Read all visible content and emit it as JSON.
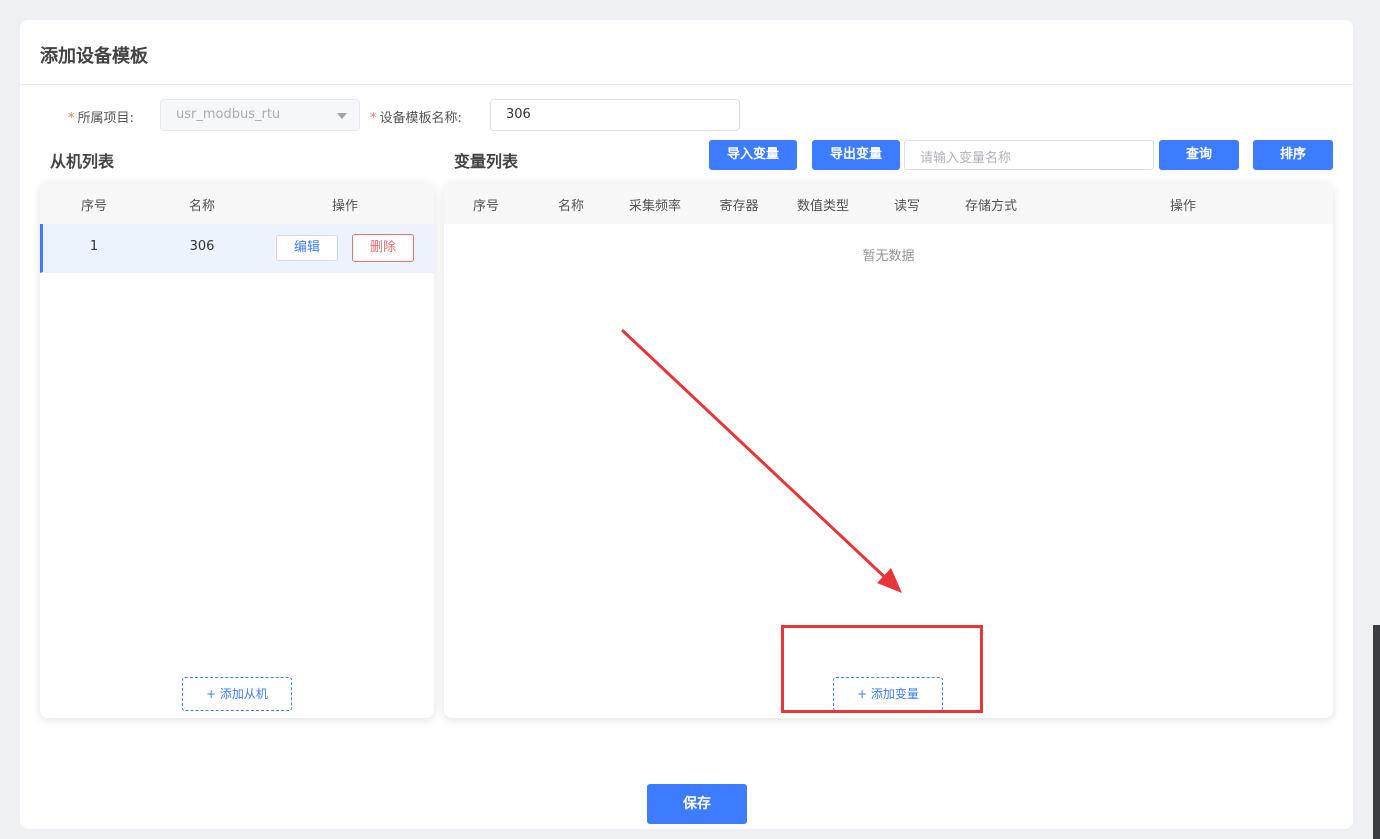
{
  "dialog": {
    "title": "添加设备模板"
  },
  "form": {
    "project_label": "所属项目:",
    "project_value": "usr_modbus_rtu",
    "required_mark": "*",
    "template_name_label": "设备模板名称:",
    "template_name_value": "306"
  },
  "slave_list": {
    "title": "从机列表",
    "columns": [
      "序号",
      "名称",
      "操作"
    ],
    "rows": [
      {
        "index": "1",
        "name": "306",
        "edit_label": "编辑",
        "delete_label": "删除"
      }
    ],
    "add_label": "+ 添加从机"
  },
  "variable_list": {
    "title": "变量列表",
    "import_label": "导入变量",
    "export_label": "导出变量",
    "search_placeholder": "请输入变量名称",
    "query_label": "查询",
    "sort_label": "排序",
    "columns": [
      "序号",
      "名称",
      "采集频率",
      "寄存器",
      "数值类型",
      "读写",
      "存储方式",
      "操作"
    ],
    "empty_text": "暂无数据",
    "add_label": "+ 添加变量"
  },
  "save_label": "保存",
  "colors": {
    "primary": "#3d7bff",
    "danger": "#f56c6c",
    "annotation": "#e8353a"
  },
  "icons": {
    "select_caret": "triangle-down",
    "annotation_arrow": "arrow"
  }
}
